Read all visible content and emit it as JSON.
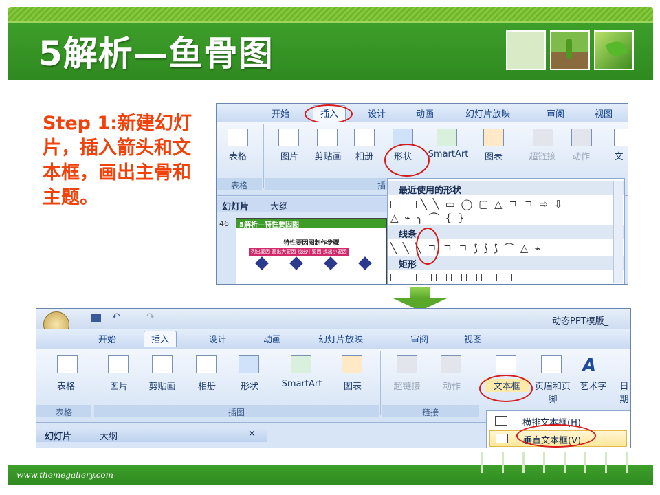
{
  "slide": {
    "title": "5解析—鱼骨图",
    "step_text": "Step 1:新建幻灯片，插入箭头和文本框，画出主骨和主题。",
    "footer_url": "www.themegallery.com"
  },
  "shot1": {
    "tabs": [
      "开始",
      "插入",
      "设计",
      "动画",
      "幻灯片放映",
      "审阅",
      "视图"
    ],
    "buttons": [
      "表格",
      "图片",
      "剪贴画",
      "相册",
      "形状",
      "SmartArt",
      "图表",
      "超链接",
      "动作",
      "文"
    ],
    "group_labels": [
      "表格",
      "插"
    ],
    "slide_tabs": [
      "幻灯片",
      "大纲"
    ],
    "slide_number": "46",
    "dropdown": {
      "recent_header": "最近使用的形状",
      "lines_header": "线条",
      "rect_header": "矩形",
      "recent_row1": "╲ ╲ ▭ ◯ ▢ △ ㄱ ㄱ ⇨ ⇩",
      "recent_row2": "△ ⌁ ╮ ⌒ { }",
      "lines_row": "╲ ╲ ╲ ㄱ ㄱ ㄱ ⟆ ⟆ ⟆ ⌒ △ ⌁"
    },
    "mini_slide": {
      "title_bar": "5解析—特性要因图",
      "heading": "特性要因图制作步骤",
      "row": "列出要因  画出大要因  找出中要因  找出小要因"
    }
  },
  "shot2": {
    "tabs": [
      "开始",
      "插入",
      "设计",
      "动画",
      "幻灯片放映",
      "审阅",
      "视图"
    ],
    "window_title": "动态PPT模版_",
    "buttons": [
      "表格",
      "图片",
      "剪贴画",
      "相册",
      "形状",
      "SmartArt",
      "图表",
      "超链接",
      "动作",
      "文本框",
      "页眉和页脚",
      "艺术字",
      "日期"
    ],
    "group_labels": [
      "表格",
      "插图",
      "链接"
    ],
    "slide_tabs": [
      "幻灯片",
      "大纲"
    ],
    "close_glyph": "✕",
    "dropdown_items": [
      "横排文本框(H)",
      "垂直文本框(V)"
    ]
  }
}
